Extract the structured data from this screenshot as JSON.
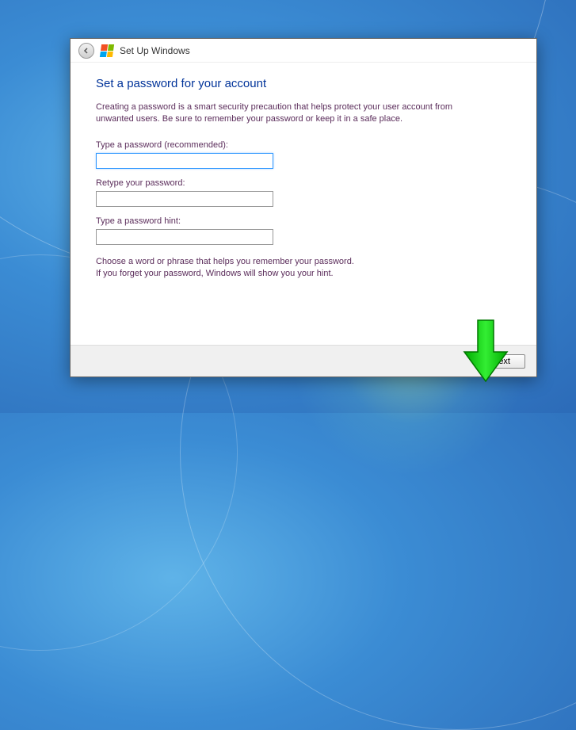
{
  "titlebar": {
    "title": "Set Up Windows"
  },
  "main": {
    "heading": "Set a password for your account",
    "description": "Creating a password is a smart security precaution that helps protect your user account from unwanted users. Be sure to remember your password or keep it in a safe place.",
    "fields": {
      "password_label": "Type a password (recommended):",
      "password_value": "",
      "retype_label": "Retype your password:",
      "retype_value": "",
      "hint_label": "Type a password hint:",
      "hint_value": ""
    },
    "hint_text_line1": "Choose a word or phrase that helps you remember your password.",
    "hint_text_line2": "If you forget your password, Windows will show you your hint."
  },
  "buttons": {
    "next": "Next"
  },
  "overlay": {
    "arrow_color": "#00CC00"
  }
}
